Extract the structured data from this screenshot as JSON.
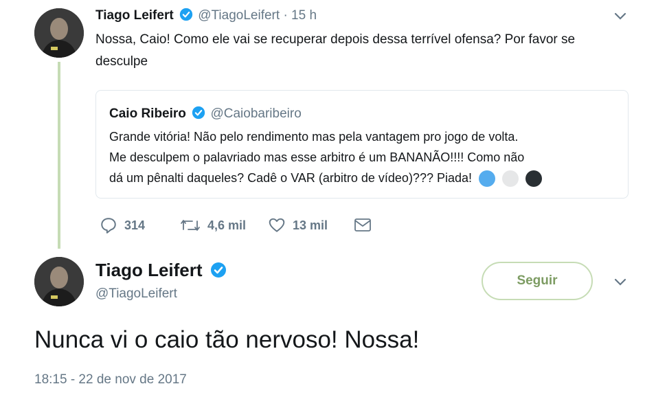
{
  "reply_tweet": {
    "author_name": "Tiago Leifert",
    "author_handle": "@TiagoLeifert",
    "time_ago": "· 15 h",
    "text_line1": "Nossa, Caio! Como ele vai se recuperar depois dessa terrível ofensa? Por favor se",
    "text_line2": "desculpe",
    "avatar_icon": "person-photo"
  },
  "quoted_tweet": {
    "author_name": "Caio Ribeiro",
    "author_handle": "@Caiobaribeiro",
    "text_line1": "Grande vitória! Não pelo rendimento mas pela vantagem pro jogo de volta.",
    "text_line2": "Me desculpem o palavriado mas esse arbitro é um BANANÃO!!!! Como não",
    "text_line3": "dá um pênalti daqueles? Cadê o VAR (arbitro de vídeo)??? Piada!",
    "emoji_colors": [
      "#55acee",
      "#e6e7e8",
      "#292f33"
    ]
  },
  "actions": {
    "reply_count": "314",
    "retweet_count": "4,6 mil",
    "like_count": "13 mil"
  },
  "main_tweet": {
    "author_name": "Tiago Leifert",
    "author_handle": "@TiagoLeifert",
    "follow_label": "Seguir",
    "text": "Nunca vi o caio tão nervoso! Nossa!",
    "timestamp": "18:15 - 22 de nov de 2017"
  },
  "colors": {
    "verified": "#1da1f2",
    "thread_line": "#c6dcb5",
    "follow_accent": "#7d9c63",
    "muted": "#657786"
  }
}
